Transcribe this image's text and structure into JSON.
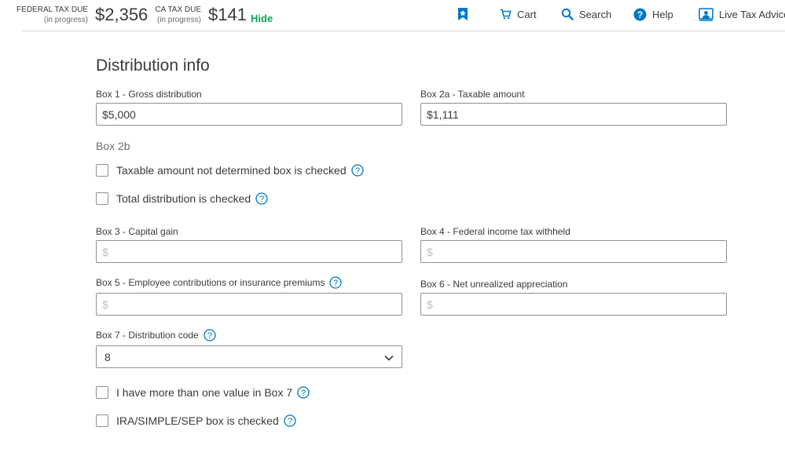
{
  "header": {
    "federal": {
      "label": "FEDERAL TAX DUE",
      "sub": "(in progress)",
      "amount": "$2,356"
    },
    "ca": {
      "label": "CA TAX DUE",
      "sub": "(in progress)",
      "amount": "$141"
    },
    "hide_label": "Hide",
    "nav": {
      "cart": "Cart",
      "search": "Search",
      "help": "Help",
      "advice": "Live Tax Advice"
    },
    "icons": [
      "bookmark-icon",
      "cart-icon",
      "search-icon",
      "help-icon",
      "live-advice-icon"
    ],
    "accent_color": "#0ca05d",
    "icon_color": "#0077c5"
  },
  "form": {
    "title": "Distribution info",
    "box1": {
      "label": "Box 1 - Gross distribution",
      "value": "$5,000"
    },
    "box2a": {
      "label": "Box 2a - Taxable amount",
      "value": "$1,111"
    },
    "box2b": {
      "label": "Box 2b",
      "taxable_not_determined": "Taxable amount not determined box is checked",
      "total_distribution": "Total distribution is checked"
    },
    "box3": {
      "label": "Box 3 - Capital gain",
      "placeholder": "$"
    },
    "box4": {
      "label": "Box 4 - Federal income tax withheld",
      "placeholder": "$"
    },
    "box5": {
      "label": "Box 5 - Employee contributions or insurance premiums",
      "placeholder": "$"
    },
    "box6": {
      "label": "Box 6 - Net unrealized appreciation",
      "placeholder": "$"
    },
    "box7": {
      "label": "Box 7 - Distribution code",
      "value": "8"
    },
    "more_than_one": "I have more than one value in Box 7",
    "ira_sep": "IRA/SIMPLE/SEP box is checked"
  }
}
